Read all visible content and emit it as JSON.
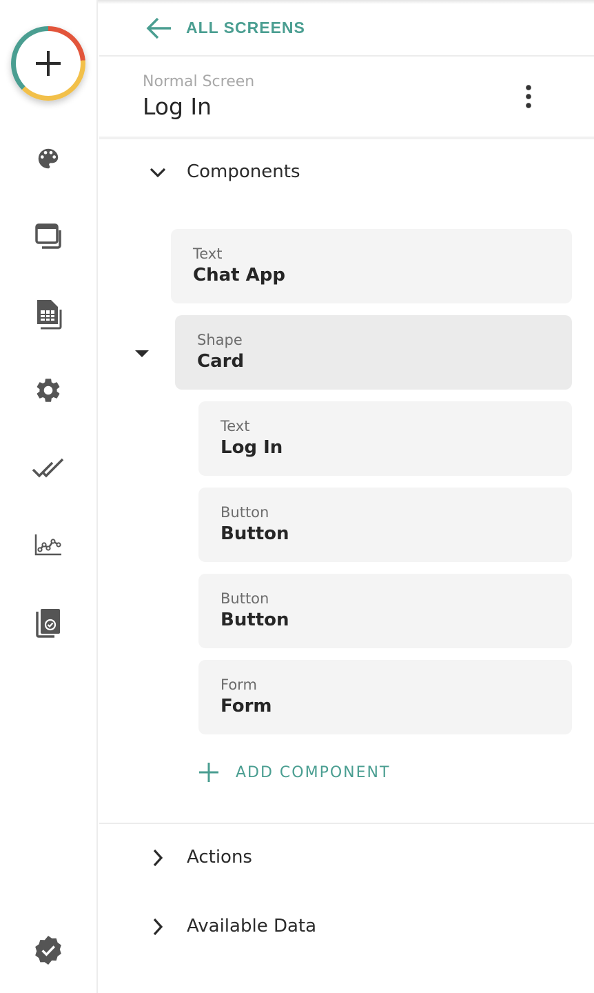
{
  "nav": {
    "back_label": "ALL SCREENS"
  },
  "screen": {
    "type": "Normal Screen",
    "name": "Log In"
  },
  "sections": {
    "components": "Components",
    "actions": "Actions",
    "available_data": "Available Data"
  },
  "components": [
    {
      "type": "Text",
      "name": "Chat App"
    },
    {
      "type": "Shape",
      "name": "Card"
    },
    {
      "type": "Text",
      "name": "Log In"
    },
    {
      "type": "Button",
      "name": "Button"
    },
    {
      "type": "Button",
      "name": "Button"
    },
    {
      "type": "Form",
      "name": "Form"
    }
  ],
  "add_component_label": "ADD COMPONENT",
  "sidebar_icons": [
    "add-icon",
    "palette-icon",
    "screens-icon",
    "database-icon",
    "settings-icon",
    "done-all-icon",
    "analytics-icon",
    "publish-check-icon",
    "verified-icon"
  ],
  "colors": {
    "accent": "#4a9e91",
    "fab_red": "#e2553b",
    "fab_yellow": "#f2c04a",
    "fab_teal": "#4a9e91",
    "icon_gray": "#555555"
  }
}
